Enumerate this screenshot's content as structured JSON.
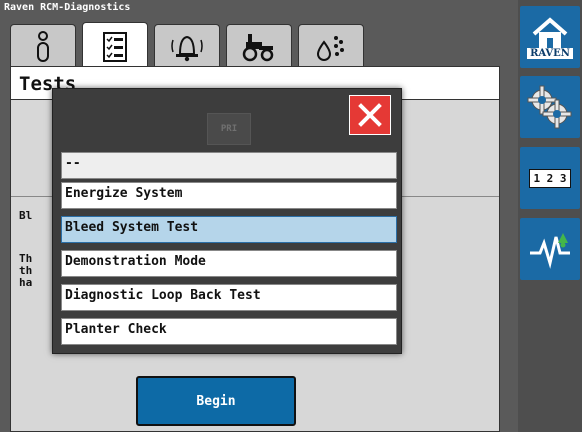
{
  "app": {
    "title": "Raven RCM-Diagnostics"
  },
  "tabs": [
    {
      "id": "info",
      "icon": "info-icon"
    },
    {
      "id": "tests",
      "icon": "checklist-icon",
      "active": true
    },
    {
      "id": "alarms",
      "icon": "alarm-bell-icon"
    },
    {
      "id": "machine",
      "icon": "tractor-icon"
    },
    {
      "id": "product",
      "icon": "liquid-drops-icon"
    }
  ],
  "panel": {
    "title": "Tests",
    "begin_label": "Begin"
  },
  "modal": {
    "ghost_label": "PRI",
    "placeholder": "--",
    "options": [
      {
        "label": "Energize System",
        "selected": false
      },
      {
        "label": "Bleed System Test",
        "selected": true
      },
      {
        "label": "Demonstration Mode",
        "selected": false
      },
      {
        "label": "Diagnostic Loop Back Test",
        "selected": false
      },
      {
        "label": "Planter Check",
        "selected": false
      }
    ],
    "occluded_text": [
      "Bl",
      "Th",
      "th",
      "ha"
    ]
  },
  "sidebar": {
    "home_label": "RAVEN",
    "keypad_label": "1 2 3",
    "buttons": [
      "home-icon",
      "gears-icon",
      "keypad-icon",
      "diagnostics-icon"
    ]
  },
  "colors": {
    "accent_blue": "#1b6aa5",
    "selected_row": "#b5d5ea",
    "close_red": "#e53935",
    "modal_bg": "#3d3d3d"
  }
}
